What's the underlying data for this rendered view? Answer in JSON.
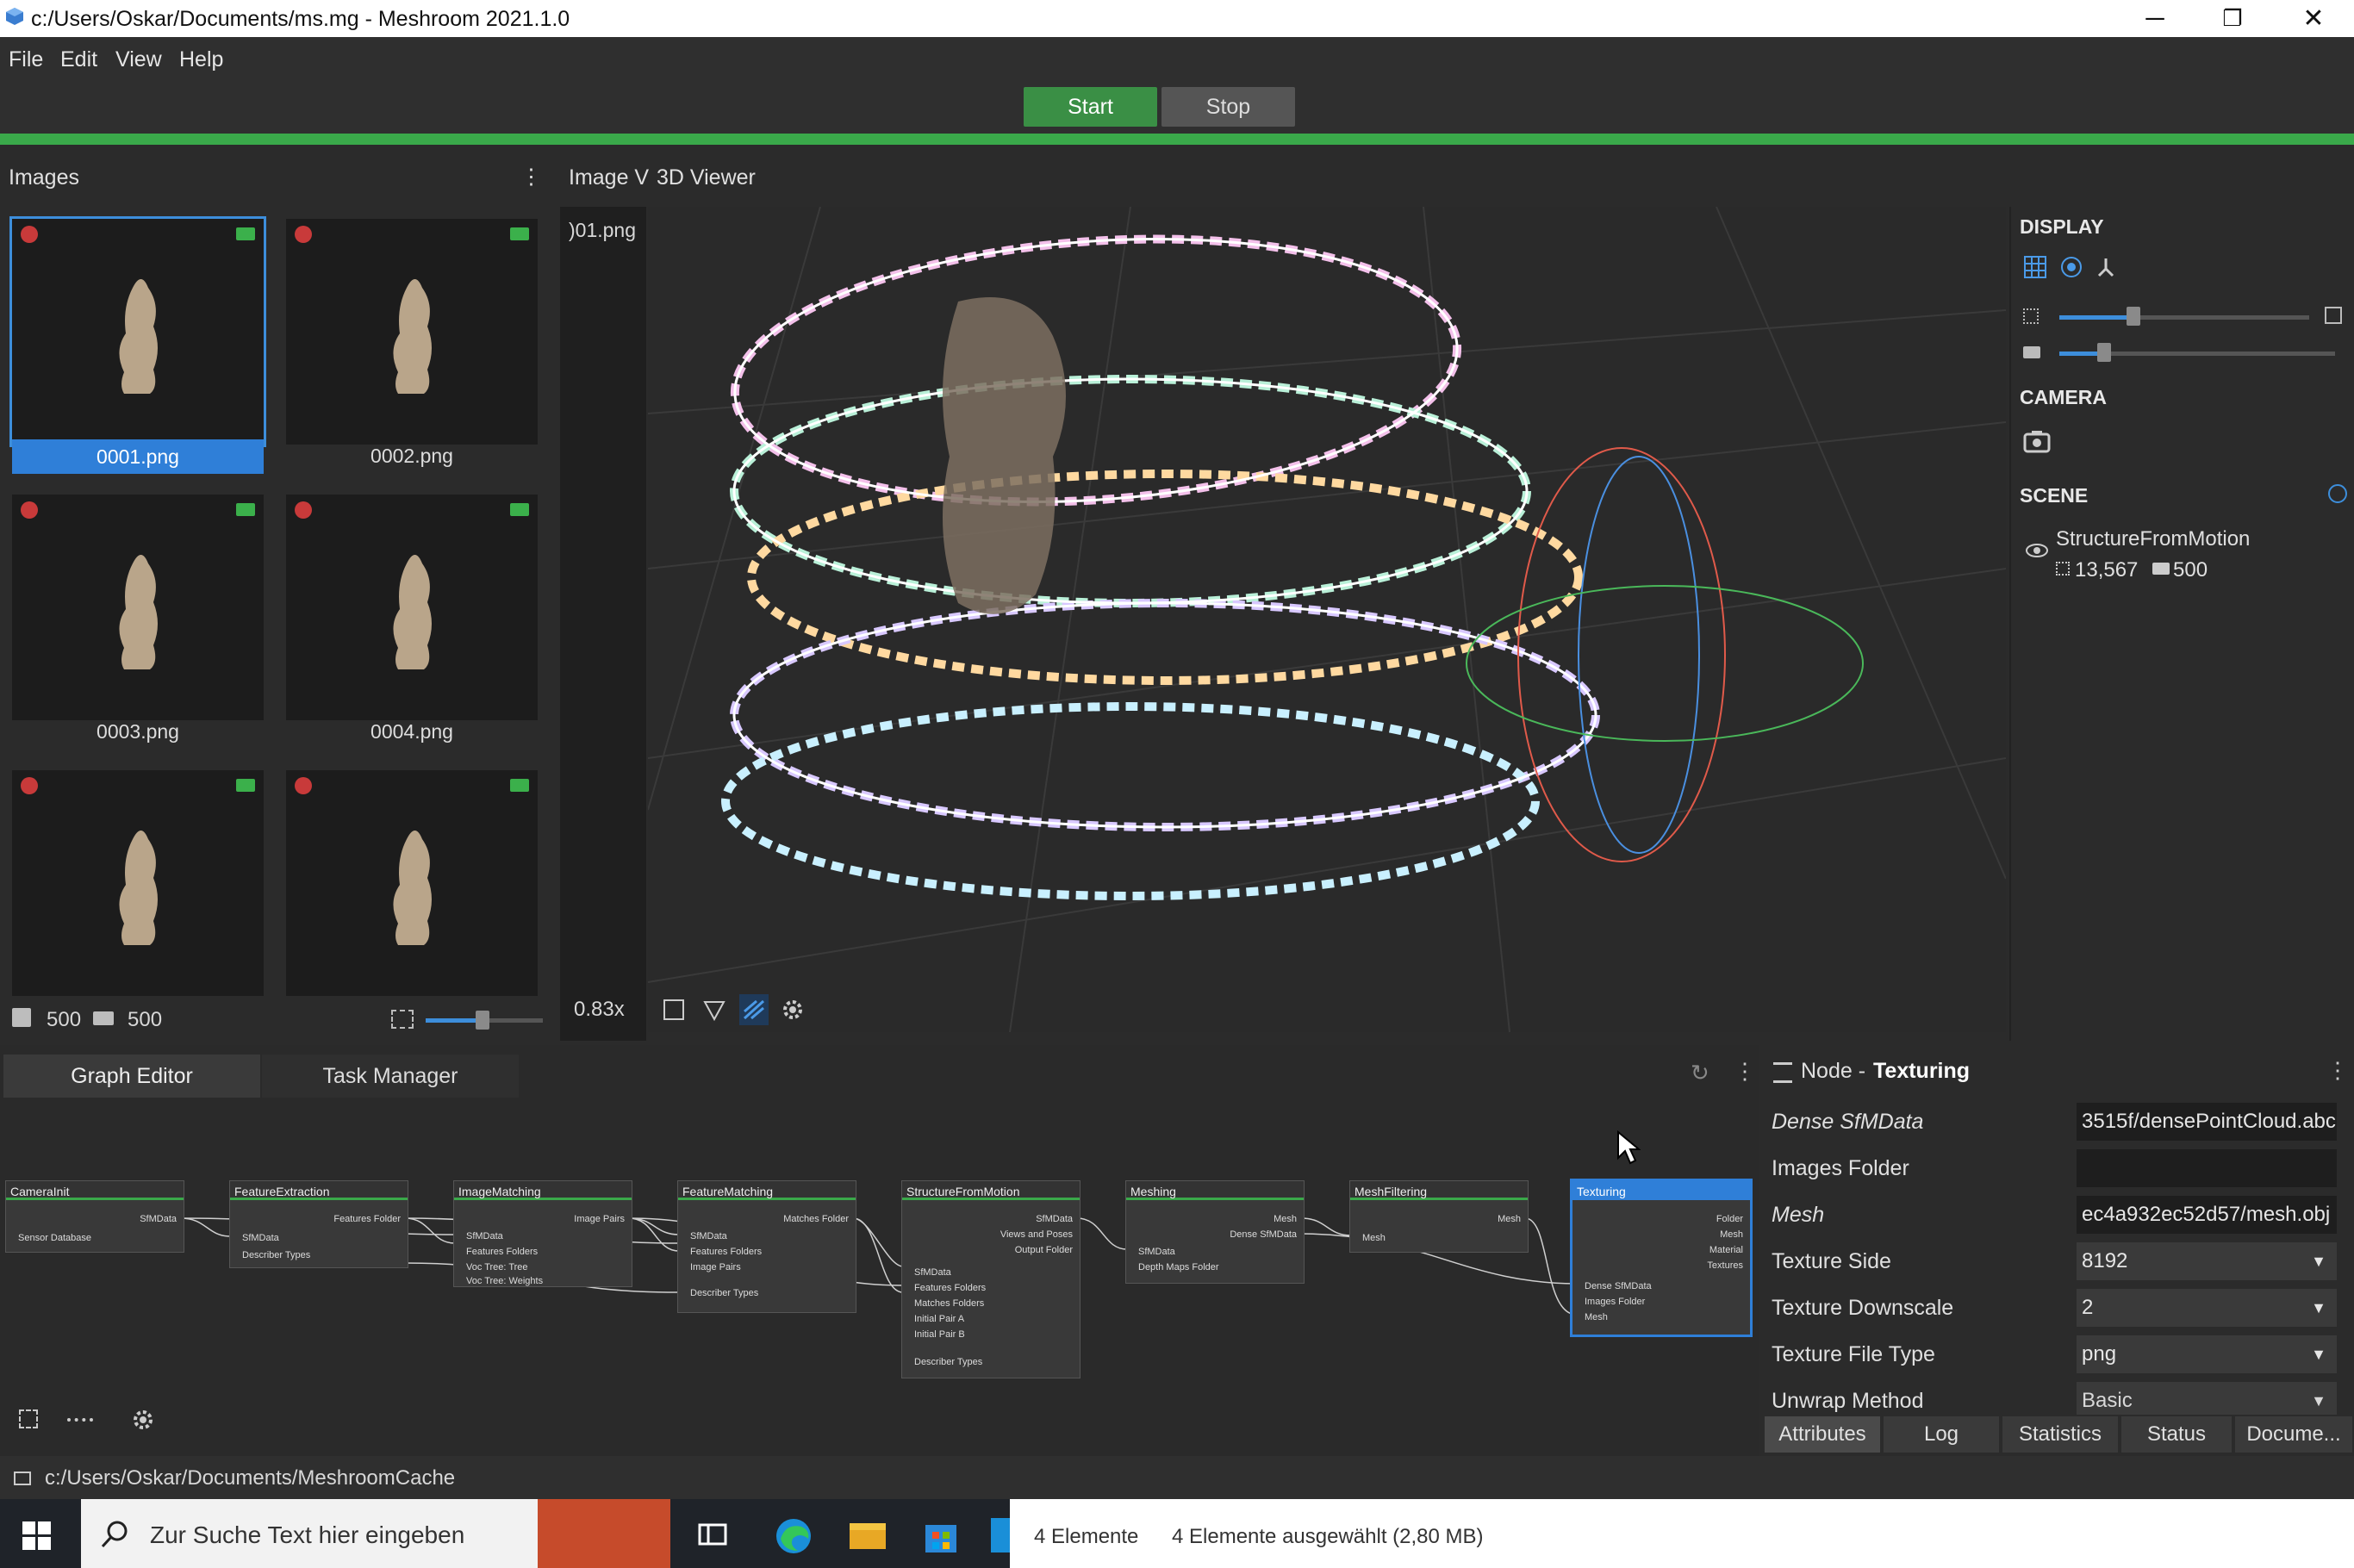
{
  "window": {
    "title": "c:/Users/Oskar/Documents/ms.mg - Meshroom 2021.1.0",
    "minimize": "─",
    "maximize": "❐",
    "close": "✕"
  },
  "menu": [
    "File",
    "Edit",
    "View",
    "Help"
  ],
  "toolbar": {
    "start": "Start",
    "stop": "Stop"
  },
  "images_panel": {
    "title": "Images",
    "menu_icon": "⋮",
    "thumbs": [
      "0001.png",
      "0002.png",
      "0003.png",
      "0004.png",
      "",
      ""
    ],
    "image_count": "500",
    "camera_count": "500"
  },
  "viewer": {
    "tab_image": "Image V",
    "tab_3d": "3D Viewer",
    "strip_label": ")01.png",
    "zoom": "0.83x"
  },
  "display": {
    "display_title": "DISPLAY",
    "camera_title": "CAMERA",
    "scene_title": "SCENE",
    "scene_item": "StructureFromMotion",
    "points": "13,567",
    "cameras": "500"
  },
  "graph": {
    "tab_graph": "Graph Editor",
    "tab_tasks": "Task Manager",
    "nodes": [
      {
        "title": "CameraInit",
        "outputs": [
          "SfMData"
        ],
        "inputs": [
          "Sensor Database"
        ]
      },
      {
        "title": "FeatureExtraction",
        "outputs": [
          "Features Folder"
        ],
        "inputs": [
          "SfMData",
          "Describer Types"
        ]
      },
      {
        "title": "ImageMatching",
        "outputs": [
          "Image Pairs"
        ],
        "inputs": [
          "SfMData",
          "Features Folders",
          "Voc Tree: Tree",
          "Voc Tree: Weights"
        ]
      },
      {
        "title": "FeatureMatching",
        "outputs": [
          "Matches Folder"
        ],
        "inputs": [
          "SfMData",
          "Features Folders",
          "Image Pairs",
          "Describer Types"
        ]
      },
      {
        "title": "StructureFromMotion",
        "outputs": [
          "SfMData",
          "Views and Poses",
          "Output Folder"
        ],
        "inputs": [
          "SfMData",
          "Features Folders",
          "Matches Folders",
          "Initial Pair A",
          "Initial Pair B",
          "Describer Types"
        ]
      },
      {
        "title": "Meshing",
        "outputs": [
          "Mesh",
          "Dense SfMData"
        ],
        "inputs": [
          "SfMData",
          "Depth Maps Folder"
        ]
      },
      {
        "title": "MeshFiltering",
        "outputs": [
          "Mesh"
        ],
        "inputs": [
          "Mesh"
        ]
      },
      {
        "title": "Texturing",
        "outputs": [
          "Folder",
          "Mesh",
          "Material",
          "Textures"
        ],
        "inputs": [
          "Dense SfMData",
          "Images Folder",
          "Mesh"
        ]
      }
    ]
  },
  "node_panel": {
    "prefix": "Node - ",
    "name": "Texturing",
    "attributes": [
      {
        "label": "Dense SfMData",
        "value": "3515f/densePointCloud.abc"
      },
      {
        "label": "Images Folder",
        "value": ""
      },
      {
        "label": "Mesh",
        "value": "ec4a932ec52d57/mesh.obj"
      },
      {
        "label": "Texture Side",
        "value": "8192"
      },
      {
        "label": "Texture Downscale",
        "value": "2"
      },
      {
        "label": "Texture File Type",
        "value": "png"
      },
      {
        "label": "Unwrap Method",
        "value": "Basic"
      }
    ],
    "tabs": [
      "Attributes",
      "Log",
      "Statistics",
      "Status",
      "Docume..."
    ]
  },
  "statusbar": {
    "path": "c:/Users/Oskar/Documents/MeshroomCache"
  },
  "taskbar": {
    "search_placeholder": "Zur Suche Text hier eingeben",
    "explorer_count": "4 Elemente",
    "explorer_selected": "4 Elemente ausgewählt (2,80 MB)"
  },
  "colors": {
    "accent": "#2f7fd8",
    "progress": "#3aa94a",
    "start_button": "#3a8f45"
  }
}
